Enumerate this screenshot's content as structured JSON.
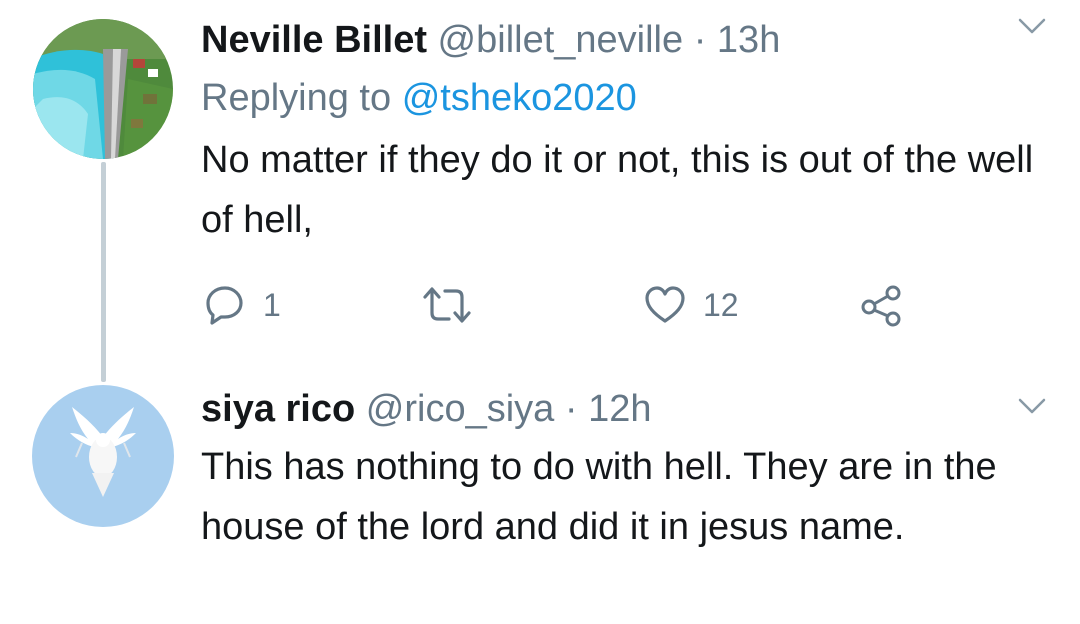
{
  "tweets": [
    {
      "author_name": "Neville Billet",
      "handle": "@billet_neville",
      "separator": "·",
      "time": "13h",
      "replying_prefix": "Replying to",
      "replying_to": "@tsheko2020",
      "text": "No matter if they do it or not, this is out of the well of hell,",
      "reply_count": "1",
      "like_count": "12",
      "avatar_icon": "lake-landscape-avatar"
    },
    {
      "author_name": "siya rico",
      "handle": "@rico_siya",
      "separator": "·",
      "time": "12h",
      "text": "This has nothing to do with hell. They are in the house of the lord and did it in jesus name.",
      "avatar_icon": "white-dove-avatar"
    }
  ],
  "colors": {
    "text_primary": "#14171a",
    "text_secondary": "#657786",
    "link": "#1b95e0",
    "thread_line": "#c4cfd6"
  }
}
